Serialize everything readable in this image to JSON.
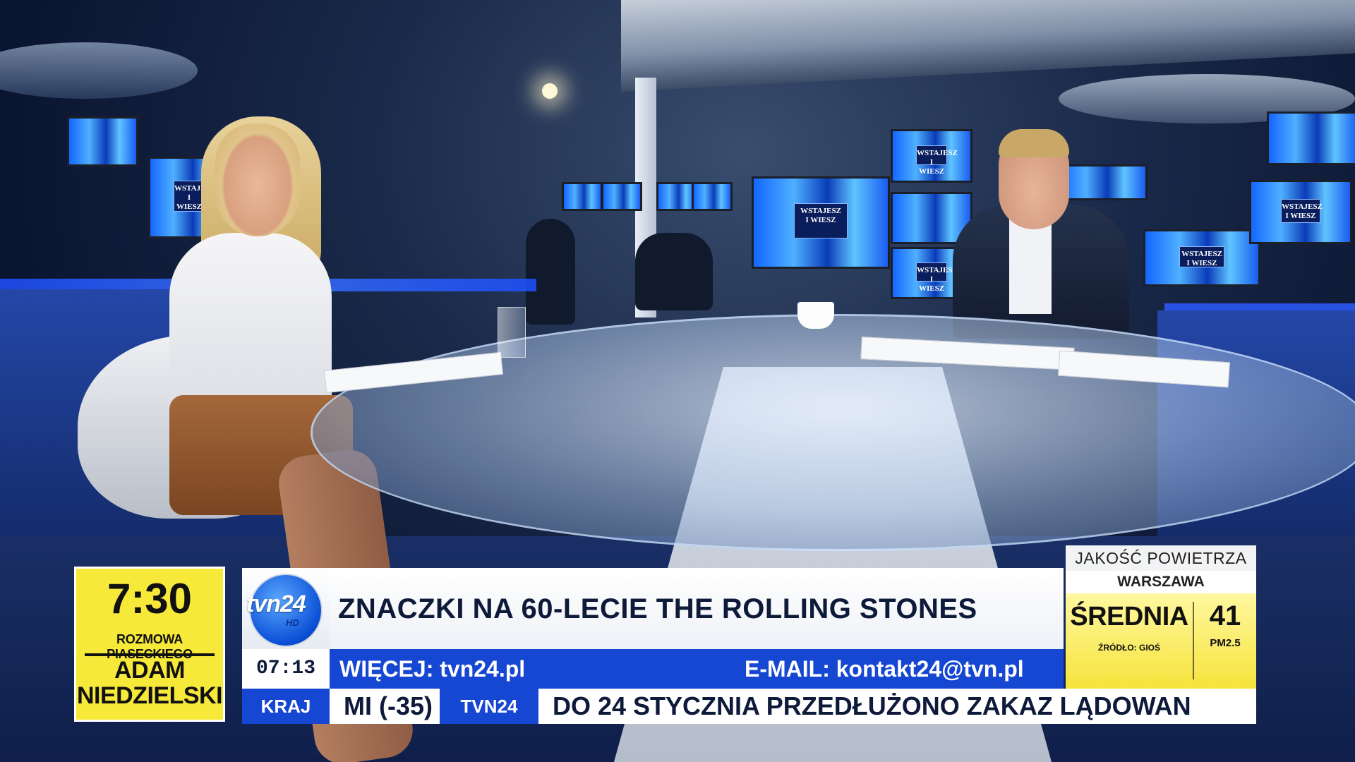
{
  "program": {
    "time": "7:30",
    "show_name": "ROZMOWA PIASECKIEGO",
    "guest_line1": "ADAM",
    "guest_line2": "NIEDZIELSKI"
  },
  "channel": {
    "logo_text": "tvn24",
    "logo_suffix": "HD"
  },
  "headline": "ZNACZKI NA 60-LECIE THE ROLLING STONES",
  "info": {
    "clock": "07:13",
    "more": "WIĘCEJ: tvn24.pl",
    "email": "E-MAIL: kontakt24@tvn.pl"
  },
  "ticker": {
    "category": "KRAJ",
    "previous_fragment": "MI (-35)",
    "source": "TVN24",
    "text": "DO 24 STYCZNIA PRZEDŁUŻONO ZAKAZ LĄDOWAN"
  },
  "air_quality": {
    "title": "JAKOŚĆ POWIETRZA",
    "city": "WARSZAWA",
    "level": "ŚREDNIA",
    "source": "ŹRÓDŁO: GIOŚ",
    "value": "41",
    "unit": "PM2.5"
  },
  "studio_screens": {
    "label_line1": "WSTAJESZ",
    "label_line2": "I WIESZ"
  },
  "colors": {
    "accent_blue": "#1647d3",
    "highlight_yellow": "#f7e93a"
  }
}
